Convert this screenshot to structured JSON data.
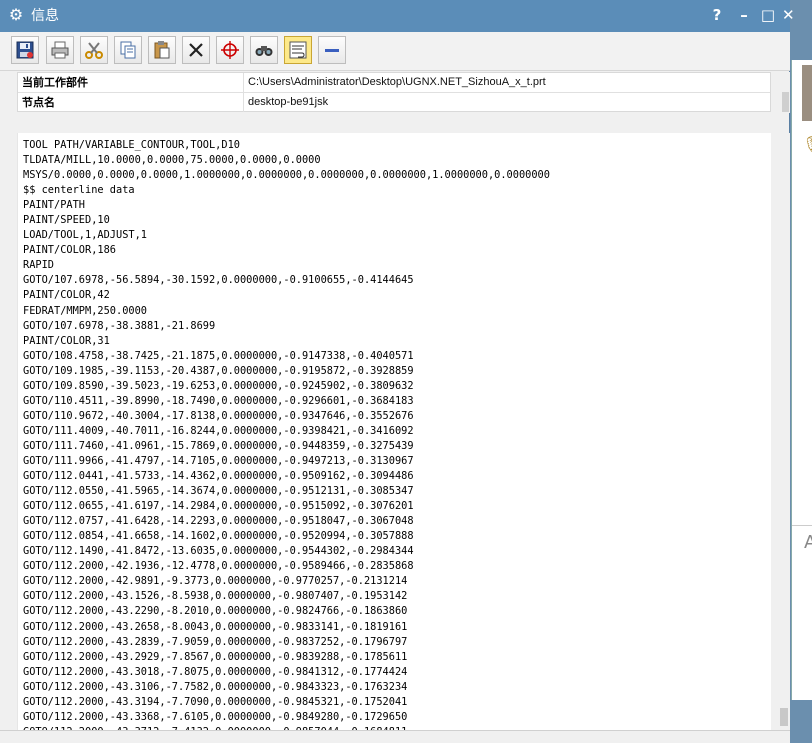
{
  "window": {
    "title": "信息",
    "help_label": "?",
    "minimize_label": "–",
    "maximize_label": "□",
    "close_label": "✕"
  },
  "toolbar": {
    "tools": [
      {
        "name": "save",
        "icon": "save-icon"
      },
      {
        "name": "print",
        "icon": "printer-icon"
      },
      {
        "name": "cut",
        "icon": "scissors-icon"
      },
      {
        "name": "copy",
        "icon": "copy-icon"
      },
      {
        "name": "paste",
        "icon": "paste-icon"
      },
      {
        "name": "delete",
        "icon": "delete-icon"
      },
      {
        "name": "crosshair",
        "icon": "crosshair-icon"
      },
      {
        "name": "find",
        "icon": "binoculars-icon"
      },
      {
        "name": "wrap",
        "icon": "wrap-text-icon",
        "active": true
      },
      {
        "name": "collapse",
        "icon": "minus-icon"
      }
    ]
  },
  "info": {
    "rows": [
      {
        "key": "当前工作部件",
        "value": "C:\\Users\\Administrator\\Desktop\\UGNX.NET_SizhouA_x_t.prt"
      },
      {
        "key": "节点名",
        "value": "desktop-be91jsk"
      }
    ]
  },
  "content": {
    "lines": [
      "TOOL PATH/VARIABLE_CONTOUR,TOOL,D10",
      "TLDATA/MILL,10.0000,0.0000,75.0000,0.0000,0.0000",
      "MSYS/0.0000,0.0000,0.0000,1.0000000,0.0000000,0.0000000,0.0000000,1.0000000,0.0000000",
      "$$ centerline data",
      "PAINT/PATH",
      "PAINT/SPEED,10",
      "LOAD/TOOL,1,ADJUST,1",
      "PAINT/COLOR,186",
      "RAPID",
      "GOTO/107.6978,-56.5894,-30.1592,0.0000000,-0.9100655,-0.4144645",
      "PAINT/COLOR,42",
      "FEDRAT/MMPM,250.0000",
      "GOTO/107.6978,-38.3881,-21.8699",
      "PAINT/COLOR,31",
      "GOTO/108.4758,-38.7425,-21.1875,0.0000000,-0.9147338,-0.4040571",
      "GOTO/109.1985,-39.1153,-20.4387,0.0000000,-0.9195872,-0.3928859",
      "GOTO/109.8590,-39.5023,-19.6253,0.0000000,-0.9245902,-0.3809632",
      "GOTO/110.4511,-39.8990,-18.7490,0.0000000,-0.9296601,-0.3684183",
      "GOTO/110.9672,-40.3004,-17.8138,0.0000000,-0.9347646,-0.3552676",
      "GOTO/111.4009,-40.7011,-16.8244,0.0000000,-0.9398421,-0.3416092",
      "GOTO/111.7460,-41.0961,-15.7869,0.0000000,-0.9448359,-0.3275439",
      "GOTO/111.9966,-41.4797,-14.7105,0.0000000,-0.9497213,-0.3130967",
      "GOTO/112.0441,-41.5733,-14.4362,0.0000000,-0.9509162,-0.3094486",
      "GOTO/112.0550,-41.5965,-14.3674,0.0000000,-0.9512131,-0.3085347",
      "GOTO/112.0655,-41.6197,-14.2984,0.0000000,-0.9515092,-0.3076201",
      "GOTO/112.0757,-41.6428,-14.2293,0.0000000,-0.9518047,-0.3067048",
      "GOTO/112.0854,-41.6658,-14.1602,0.0000000,-0.9520994,-0.3057888",
      "GOTO/112.1490,-41.8472,-13.6035,0.0000000,-0.9544302,-0.2984344",
      "GOTO/112.2000,-42.1936,-12.4778,0.0000000,-0.9589466,-0.2835868",
      "GOTO/112.2000,-42.9891,-9.3773,0.0000000,-0.9770257,-0.2131214",
      "GOTO/112.2000,-43.1526,-8.5938,0.0000000,-0.9807407,-0.1953142",
      "GOTO/112.2000,-43.2290,-8.2010,0.0000000,-0.9824766,-0.1863860",
      "GOTO/112.2000,-43.2658,-8.0043,0.0000000,-0.9833141,-0.1819161",
      "GOTO/112.2000,-43.2839,-7.9059,0.0000000,-0.9837252,-0.1796797",
      "GOTO/112.2000,-43.2929,-7.8567,0.0000000,-0.9839288,-0.1785611",
      "GOTO/112.2000,-43.3018,-7.8075,0.0000000,-0.9841312,-0.1774424",
      "GOTO/112.2000,-43.3106,-7.7582,0.0000000,-0.9843323,-0.1763234",
      "GOTO/112.2000,-43.3194,-7.7090,0.0000000,-0.9845321,-0.1752041",
      "GOTO/112.2000,-43.3368,-7.6105,0.0000000,-0.9849280,-0.1729650",
      "GOTO/112.2000,-43.3712,-7.4132,0.0000000,-0.9857044,-0.1684811"
    ]
  },
  "side_panel": {
    "letter": "A"
  }
}
